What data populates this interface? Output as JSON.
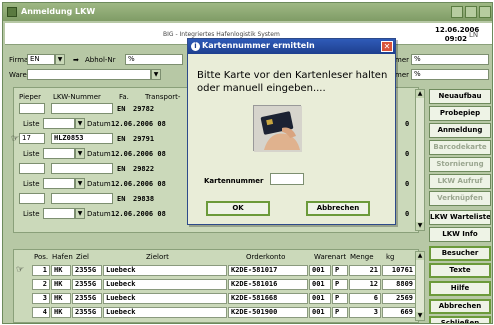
{
  "window": {
    "title": "Anmeldung LKW"
  },
  "header": {
    "system_text": "BIG - Integriertes Hafenlogistik System",
    "date": "12.06.2006",
    "time": "09:02",
    "language": "LN"
  },
  "filters": {
    "firma_label": "Firma",
    "firma_value": "EN",
    "abhol_label": "Abhol-Nr",
    "abhol_value": "%",
    "ware_label": "Ware",
    "right_label_1": "mer",
    "right_value_1": "%",
    "right_label_2": "mer",
    "right_value_2": "%"
  },
  "top_grid": {
    "headers": [
      "Pieper",
      "LKW-Nummer",
      "Fa.",
      "Transport-"
    ],
    "liste_label": "Liste",
    "datum_label": "Datum",
    "rows": [
      {
        "pieper": "",
        "lkw": "",
        "fa": "EN",
        "transport": "29782",
        "datum": "12.06.2006 08",
        "suffix": "0"
      },
      {
        "pieper": "17",
        "lkw": "HLZ0853",
        "fa": "EN",
        "transport": "29791",
        "datum": "12.06.2006 08",
        "suffix": "0"
      },
      {
        "pieper": "",
        "lkw": "",
        "fa": "EN",
        "transport": "29822",
        "datum": "12.06.2006 08",
        "suffix": "0"
      },
      {
        "pieper": "",
        "lkw": "",
        "fa": "EN",
        "transport": "29838",
        "datum": "12.06.2006 08",
        "suffix": "0"
      }
    ]
  },
  "side_buttons": [
    {
      "label": "Neuaufbau",
      "enabled": true
    },
    {
      "label": "Probepiep",
      "enabled": true
    },
    {
      "label": "Anmeldung",
      "enabled": true
    },
    {
      "label": "Barcodekarte",
      "enabled": false
    },
    {
      "label": "Stornierung",
      "enabled": false
    },
    {
      "label": "LKW Aufruf",
      "enabled": false
    },
    {
      "label": "Verknüpfen",
      "enabled": false
    },
    {
      "label": "LKW Warteliste",
      "enabled": true
    },
    {
      "label": "LKW Info",
      "enabled": true
    },
    {
      "label": "Besucher",
      "enabled": true
    },
    {
      "label": "Texte",
      "enabled": true
    },
    {
      "label": "Hilfe",
      "enabled": true
    },
    {
      "label": "Abbrechen",
      "enabled": true
    },
    {
      "label": "Schließen",
      "enabled": true
    }
  ],
  "bottom_grid": {
    "headers": [
      "Pos.",
      "Hafen",
      "Ziel",
      "Zielort",
      "Orderkonto",
      "Warenart",
      "Menge",
      "kg"
    ],
    "rows": [
      {
        "pos": "1",
        "hafen": "HK",
        "ziel": "2355G",
        "zielort": "Luebeck",
        "konto": "K2DE-581017",
        "ware": "001",
        "p": "P",
        "menge": "21",
        "kg": "10761"
      },
      {
        "pos": "2",
        "hafen": "HK",
        "ziel": "2355G",
        "zielort": "Luebeck",
        "konto": "K2DE-581016",
        "ware": "001",
        "p": "P",
        "menge": "12",
        "kg": "8809"
      },
      {
        "pos": "3",
        "hafen": "HK",
        "ziel": "2355G",
        "zielort": "Luebeck",
        "konto": "K2DE-581668",
        "ware": "001",
        "p": "P",
        "menge": "6",
        "kg": "2569"
      },
      {
        "pos": "4",
        "hafen": "HK",
        "ziel": "2355G",
        "zielort": "Luebeck",
        "konto": "K2DE-501900",
        "ware": "001",
        "p": "P",
        "menge": "3",
        "kg": "669"
      }
    ]
  },
  "dialog": {
    "title": "Kartennummer ermitteln",
    "message": "Bitte Karte vor den Kartenleser halten oder manuell eingeben....",
    "field_label": "Kartennummer",
    "field_value": "",
    "ok_label": "OK",
    "cancel_label": "Abbrechen",
    "title_bg": "#1e3f8e"
  }
}
